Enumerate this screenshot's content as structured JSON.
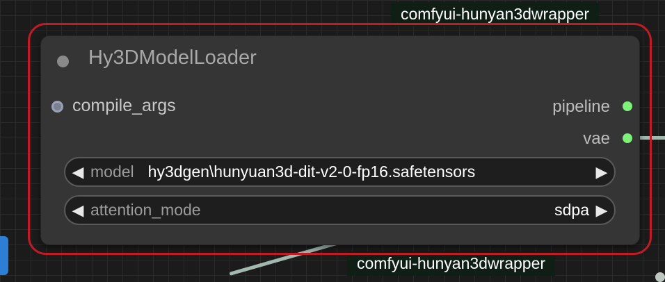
{
  "group_tags": {
    "top": "comfyui-hunyan3dwrapper",
    "bottom": "comfyui-hunyan3dwrapper"
  },
  "node": {
    "title": "Hy3DModelLoader",
    "inputs": [
      {
        "label": "compile_args"
      }
    ],
    "outputs": [
      {
        "label": "pipeline"
      },
      {
        "label": "vae"
      }
    ],
    "widgets": [
      {
        "label": "model",
        "value": "hy3dgen\\hunyuan3d-dit-v2-0-fp16.safetensors"
      },
      {
        "label": "attention_mode",
        "value": "sdpa"
      }
    ]
  },
  "colors": {
    "selection_outline": "#c21b24",
    "output_slot": "#7ff07a",
    "group_tag_bg": "#0f1f16",
    "canvas_bg": "#1b1b1b"
  },
  "icons": {
    "left_arrow": "triangle-left-icon",
    "right_arrow": "triangle-right-icon"
  }
}
